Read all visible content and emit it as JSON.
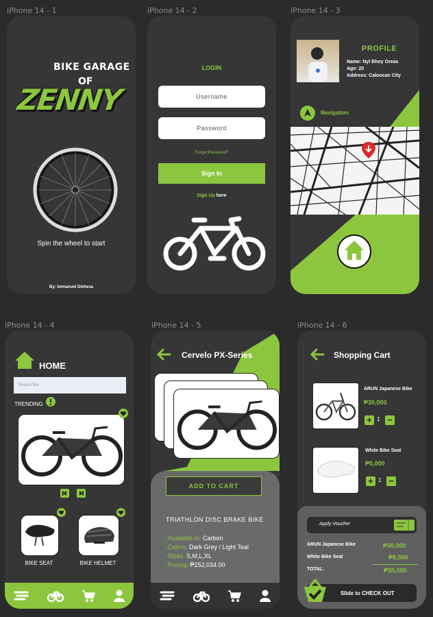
{
  "frames": [
    "iPhone 14 - 1",
    "iPhone 14 - 2",
    "iPhone 14 - 3",
    "iPhone 14 - 4",
    "iPhone 14 - 5",
    "iPhone 14 - 6"
  ],
  "colors": {
    "accent": "#8cc63f",
    "bg": "#2b2b2b",
    "phone": "#363636"
  },
  "splash": {
    "logo_line1": "BIKE GARAGE",
    "logo_line2": "OF",
    "logo_big": "ZENNY",
    "tagline": "Spin the wheel to start",
    "author": "By: Immanuel Diehesa"
  },
  "login": {
    "title": "LOGIN",
    "username_placeholder": "Username",
    "password_placeholder": "Password",
    "forgot": "Forgot Password?",
    "signin": "Sign In",
    "signup_prefix": "Sign Up",
    "signup_suffix": " here"
  },
  "profile": {
    "title": "PROFILE",
    "name": "Name: Nyl Bhoy Oreas",
    "age": "Age: 20",
    "address": "Address: Caloocan City",
    "nav_label": "Navigation"
  },
  "home": {
    "title": "HOME",
    "search_placeholder": "Search Bar",
    "trending": "TRENDING",
    "item1": "BIKE SEAT",
    "item2": "BIKE HELMET"
  },
  "product": {
    "title": "Cervelo PX-Series",
    "add_to_cart": "ADD TO CART",
    "name": "TRIATHLON DISC BRAKE BIKE",
    "available_label": "-Available in: ",
    "available_value": "Carbon",
    "colors_label": "-Colors: ",
    "colors_value": "Dark Grey / Light Teal",
    "sizes_label": "-Sizes: ",
    "sizes_value": "S,M,L,XL",
    "pricing_label": "-Pricing: ",
    "pricing_value": "₱252,034.00"
  },
  "cart": {
    "title": "Shopping Cart",
    "items": [
      {
        "name": "ARUN Japanese Bike",
        "price": "₱30,000",
        "qty": "1"
      },
      {
        "name": "White Bike Seat",
        "price": "₱5,000",
        "qty": "1"
      }
    ],
    "voucher": "Apply Voucher",
    "summary": [
      {
        "label": "ARUN Japanese Bike",
        "value": "₱30,000"
      },
      {
        "label": "White Bike Seat",
        "value": "₱5,000"
      },
      {
        "label": "TOTAL:",
        "value": "₱35,000"
      }
    ],
    "checkout": "Slide to CHECK OUT"
  }
}
